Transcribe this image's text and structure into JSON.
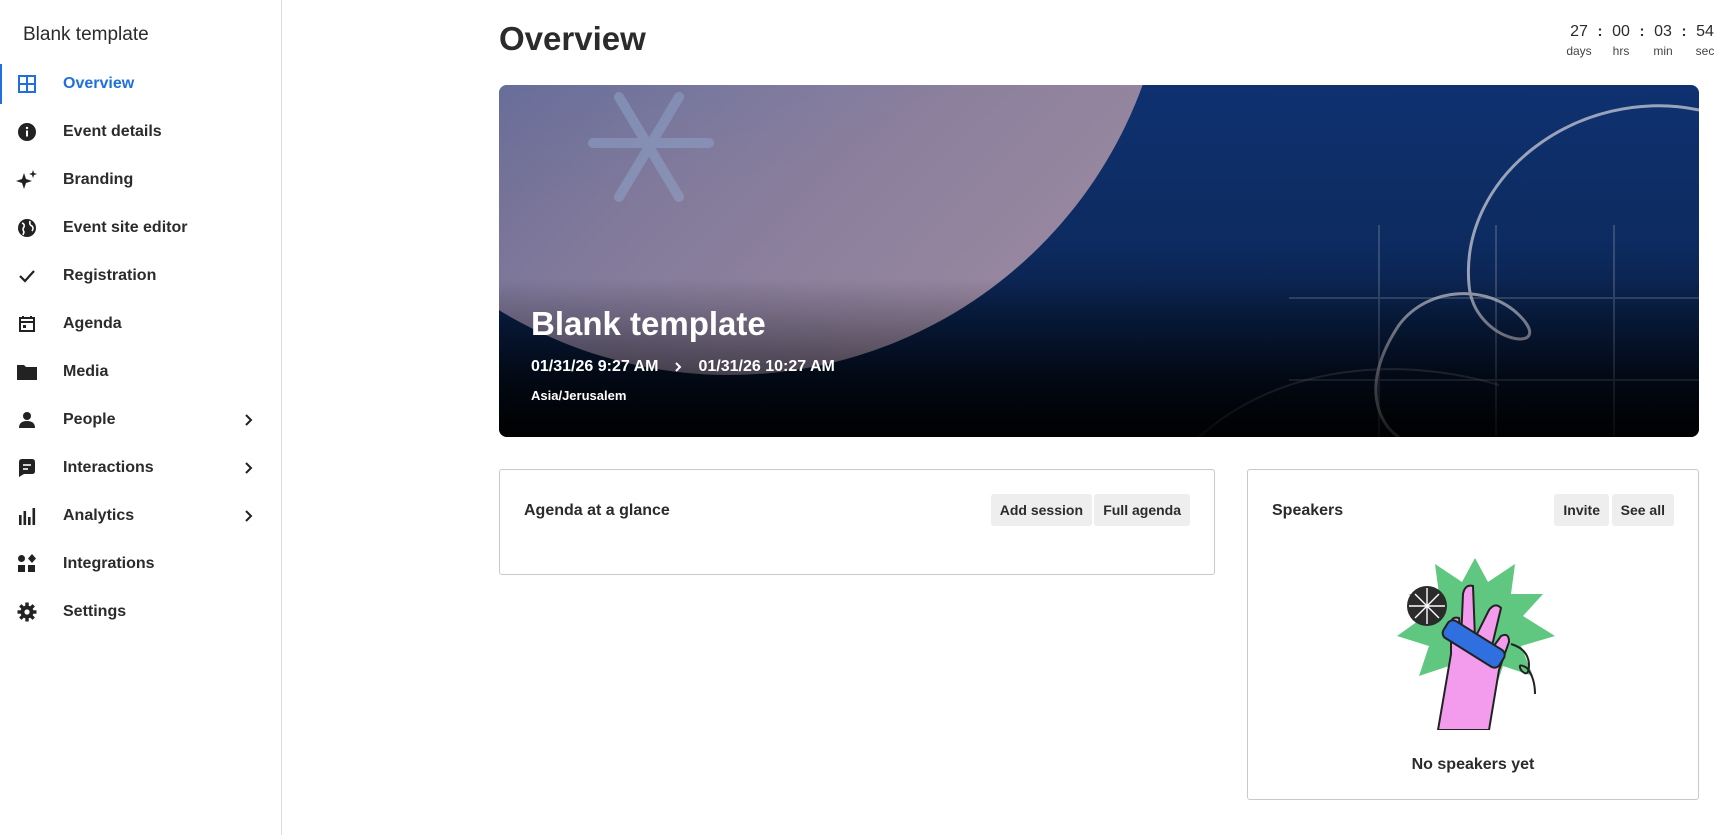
{
  "sidebar": {
    "title": "Blank template",
    "items": [
      {
        "label": "Overview",
        "icon": "grid-icon",
        "active": true
      },
      {
        "label": "Event details",
        "icon": "info-icon"
      },
      {
        "label": "Branding",
        "icon": "sparkles-icon"
      },
      {
        "label": "Event site editor",
        "icon": "globe-icon"
      },
      {
        "label": "Registration",
        "icon": "check-icon"
      },
      {
        "label": "Agenda",
        "icon": "calendar-icon"
      },
      {
        "label": "Media",
        "icon": "folder-icon"
      },
      {
        "label": "People",
        "icon": "person-icon",
        "expandable": true
      },
      {
        "label": "Interactions",
        "icon": "chat-icon",
        "expandable": true
      },
      {
        "label": "Analytics",
        "icon": "bar-chart-icon",
        "expandable": true
      },
      {
        "label": "Integrations",
        "icon": "integrations-icon"
      },
      {
        "label": "Settings",
        "icon": "gear-icon"
      }
    ]
  },
  "header": {
    "title": "Overview"
  },
  "countdown": {
    "days": "27",
    "hours": "00",
    "minutes": "03",
    "seconds": "54",
    "days_label": "days",
    "hours_label": "hrs",
    "minutes_label": "min",
    "seconds_label": "sec"
  },
  "hero": {
    "title": "Blank template",
    "start": "01/31/26 9:27 AM",
    "end": "01/31/26 10:27 AM",
    "timezone": "Asia/Jerusalem"
  },
  "agenda_card": {
    "title": "Agenda at a glance",
    "add_session_label": "Add session",
    "full_agenda_label": "Full agenda"
  },
  "speakers_card": {
    "title": "Speakers",
    "invite_label": "Invite",
    "see_all_label": "See all",
    "empty_text": "No speakers yet"
  },
  "colors": {
    "accent": "#1f6fde",
    "hero_top": "#0f3170",
    "hero_bottom": "#02060f",
    "button_bg": "#eeeeee"
  }
}
